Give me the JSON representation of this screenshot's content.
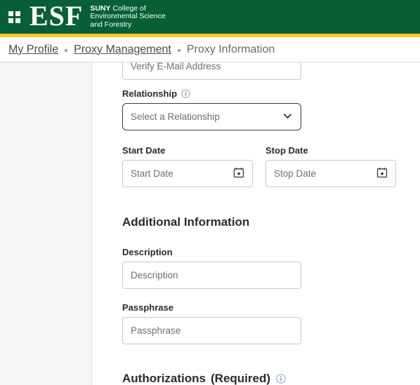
{
  "header": {
    "menu_icon": "grid-icon",
    "logo_text": "ESF",
    "logo_sub_line1_bold": "SUNY",
    "logo_sub_line1_rest": " College of",
    "logo_sub_line2": "Environmental Science",
    "logo_sub_line3": "and Forestry",
    "green": "#065F35",
    "gold": "#FBC828"
  },
  "breadcrumb": {
    "items": [
      {
        "label": "My Profile",
        "is_link": true
      },
      {
        "label": "Proxy Management",
        "is_link": true
      },
      {
        "label": "Proxy Information",
        "is_link": false
      }
    ]
  },
  "form": {
    "verify_email": {
      "label": "Verify E-Mail Address",
      "value": "",
      "placeholder": "Verify E-Mail Address"
    },
    "relationship": {
      "label": "Relationship",
      "info_icon": "info-icon",
      "selected": "Select a Relationship",
      "chevron_icon": "chevron-down-icon"
    },
    "start_date": {
      "label": "Start Date",
      "value": "",
      "placeholder": "Start Date",
      "calendar_icon": "calendar-icon"
    },
    "stop_date": {
      "label": "Stop Date",
      "value": "",
      "placeholder": "Stop Date",
      "calendar_icon": "calendar-icon"
    },
    "additional_information": {
      "title": "Additional Information",
      "description": {
        "label": "Description",
        "value": "",
        "placeholder": "Description"
      },
      "passphrase": {
        "label": "Passphrase",
        "value": "",
        "placeholder": "Passphrase"
      }
    },
    "authorizations": {
      "title": "Authorizations",
      "required_note": "(Required)",
      "info_icon": "info-icon"
    }
  }
}
